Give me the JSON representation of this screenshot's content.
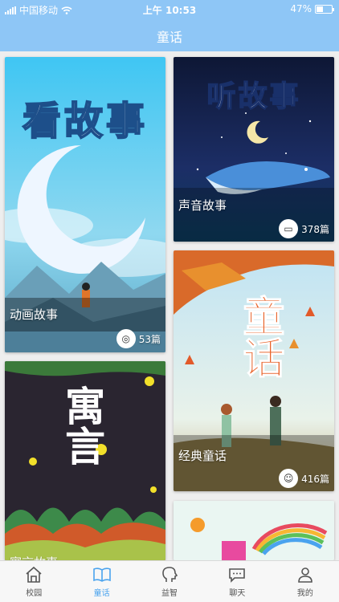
{
  "status_bar": {
    "carrier": "中国移动",
    "time": "上午 10:53",
    "battery": "47%",
    "battery_level": 0.47
  },
  "header": {
    "title": "童话"
  },
  "cards": [
    {
      "cover_title": "看故事",
      "name": "动画故事",
      "count": "53篇",
      "icon": "film-reel-icon"
    },
    {
      "cover_title": "听故事",
      "name": "声音故事",
      "count": "378篇",
      "icon": "cassette-icon"
    },
    {
      "cover_title": "童话",
      "name": "经典童话",
      "count": "416篇",
      "icon": "book-avatar-icon"
    },
    {
      "cover_title": "寓言",
      "name": "寓言故事",
      "count": "",
      "icon": ""
    },
    {
      "cover_title": "",
      "name": "",
      "count": "",
      "icon": ""
    }
  ],
  "tabs": [
    {
      "label": "校园",
      "icon": "school-house-icon",
      "active": false
    },
    {
      "label": "童话",
      "icon": "open-book-icon",
      "active": true
    },
    {
      "label": "益智",
      "icon": "head-profile-icon",
      "active": false
    },
    {
      "label": "聊天",
      "icon": "chat-bubble-icon",
      "active": false
    },
    {
      "label": "我的",
      "icon": "person-icon",
      "active": false
    }
  ],
  "colors": {
    "header": "#8ec6f6",
    "tab_active": "#4aa3ee",
    "tab_inactive": "#555555"
  }
}
